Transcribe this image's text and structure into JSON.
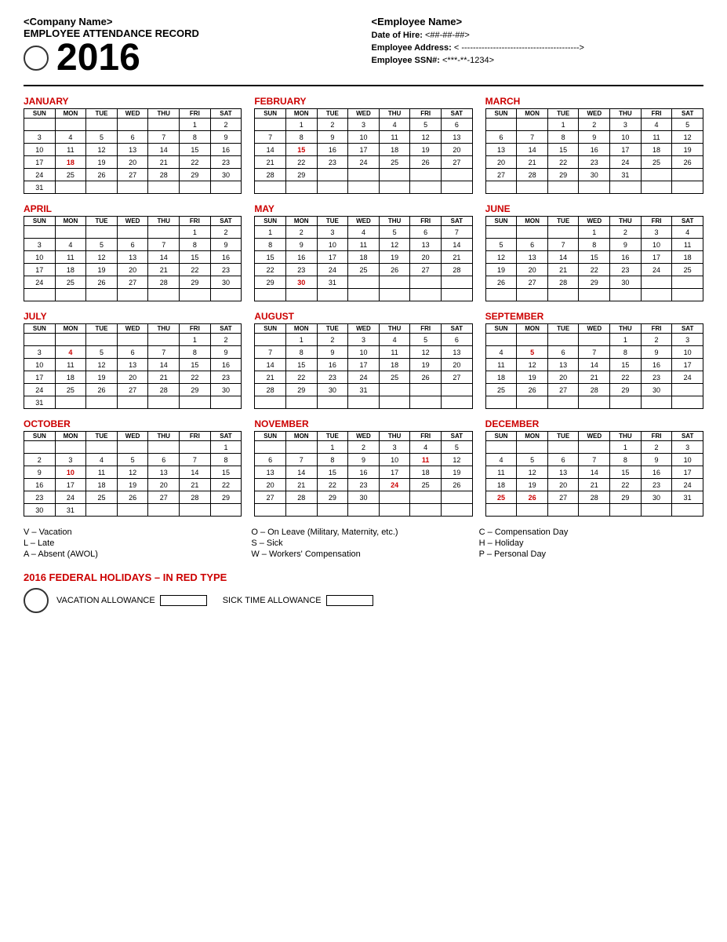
{
  "header": {
    "company_name": "<Company Name>",
    "record_title": "EMPLOYEE ATTENDANCE RECORD",
    "year": "2016",
    "employee_name": "<Employee Name>",
    "date_of_hire_label": "Date of Hire:",
    "date_of_hire_value": "<##-##-##>",
    "address_label": "Employee Address:",
    "address_value": "< ----------------------------------------->",
    "ssn_label": "Employee SSN#:",
    "ssn_value": "<***-**-1234>"
  },
  "legend": {
    "col1": [
      "V – Vacation",
      "L – Late",
      "A – Absent (AWOL)"
    ],
    "col2": [
      "O – On Leave (Military, Maternity, etc.)",
      "S – Sick",
      "W – Workers' Compensation"
    ],
    "col3": [
      "C – Compensation Day",
      "H – Holiday",
      "P – Personal Day"
    ]
  },
  "holidays_title": "2016 FEDERAL HOLIDAYS – IN RED TYPE",
  "vacation_label": "VACATION ALLOWANCE",
  "sick_label": "SICK TIME  ALLOWANCE",
  "months": [
    {
      "name": "JANUARY",
      "days": [
        [
          "",
          "",
          "",
          "",
          "",
          "1",
          "2"
        ],
        [
          "3",
          "4",
          "5",
          "6",
          "7",
          "8",
          "9"
        ],
        [
          "10",
          "11",
          "12",
          "13",
          "14",
          "15",
          "16"
        ],
        [
          "17",
          "18r",
          "19",
          "20",
          "21",
          "22",
          "23"
        ],
        [
          "24",
          "25",
          "26",
          "27",
          "28",
          "29",
          "30"
        ],
        [
          "31",
          "",
          "",
          "",
          "",
          "",
          ""
        ]
      ]
    },
    {
      "name": "FEBRUARY",
      "days": [
        [
          "",
          "1",
          "2",
          "3",
          "4",
          "5",
          "6"
        ],
        [
          "7",
          "8",
          "9",
          "10",
          "11",
          "12",
          "13"
        ],
        [
          "14",
          "15r",
          "16",
          "17",
          "18",
          "19",
          "20"
        ],
        [
          "21",
          "22",
          "23",
          "24",
          "25",
          "26",
          "27"
        ],
        [
          "28",
          "29",
          "",
          "",
          "",
          "",
          ""
        ],
        [
          "",
          "",
          "",
          "",
          "",
          "",
          ""
        ]
      ]
    },
    {
      "name": "MARCH",
      "days": [
        [
          "",
          "",
          "1",
          "2",
          "3",
          "4",
          "5"
        ],
        [
          "6",
          "7",
          "8",
          "9",
          "10",
          "11",
          "12"
        ],
        [
          "13",
          "14",
          "15",
          "16",
          "17",
          "18",
          "19"
        ],
        [
          "20",
          "21",
          "22",
          "23",
          "24",
          "25",
          "26"
        ],
        [
          "27",
          "28",
          "29",
          "30",
          "31",
          "",
          ""
        ],
        [
          "",
          "",
          "",
          "",
          "",
          "",
          ""
        ]
      ]
    },
    {
      "name": "APRIL",
      "days": [
        [
          "",
          "",
          "",
          "",
          "",
          "1",
          "2"
        ],
        [
          "3",
          "4",
          "5",
          "6",
          "7",
          "8",
          "9"
        ],
        [
          "10",
          "11",
          "12",
          "13",
          "14",
          "15",
          "16"
        ],
        [
          "17",
          "18",
          "19",
          "20",
          "21",
          "22",
          "23"
        ],
        [
          "24",
          "25",
          "26",
          "27",
          "28",
          "29",
          "30"
        ],
        [
          "",
          "",
          "",
          "",
          "",
          "",
          ""
        ]
      ]
    },
    {
      "name": "MAY",
      "days": [
        [
          "1",
          "2",
          "3",
          "4",
          "5",
          "6",
          "7"
        ],
        [
          "8",
          "9",
          "10",
          "11",
          "12",
          "13",
          "14"
        ],
        [
          "15",
          "16",
          "17",
          "18",
          "19",
          "20",
          "21"
        ],
        [
          "22",
          "23",
          "24",
          "25",
          "26",
          "27",
          "28"
        ],
        [
          "29",
          "30r",
          "31",
          "",
          "",
          "",
          ""
        ],
        [
          "",
          "",
          "",
          "",
          "",
          "",
          ""
        ]
      ]
    },
    {
      "name": "JUNE",
      "days": [
        [
          "",
          "",
          "",
          "1",
          "2",
          "3",
          "4"
        ],
        [
          "5",
          "6",
          "7",
          "8",
          "9",
          "10",
          "11"
        ],
        [
          "12",
          "13",
          "14",
          "15",
          "16",
          "17",
          "18"
        ],
        [
          "19",
          "20",
          "21",
          "22",
          "23",
          "24",
          "25"
        ],
        [
          "26",
          "27",
          "28",
          "29",
          "30",
          "",
          ""
        ],
        [
          "",
          "",
          "",
          "",
          "",
          "",
          ""
        ]
      ]
    },
    {
      "name": "JULY",
      "days": [
        [
          "",
          "",
          "",
          "",
          "",
          "1",
          "2"
        ],
        [
          "3",
          "4r",
          "5",
          "6",
          "7",
          "8",
          "9"
        ],
        [
          "10",
          "11",
          "12",
          "13",
          "14",
          "15",
          "16"
        ],
        [
          "17",
          "18",
          "19",
          "20",
          "21",
          "22",
          "23"
        ],
        [
          "24",
          "25",
          "26",
          "27",
          "28",
          "29",
          "30"
        ],
        [
          "31",
          "",
          "",
          "",
          "",
          "",
          ""
        ]
      ]
    },
    {
      "name": "AUGUST",
      "days": [
        [
          "",
          "1",
          "2",
          "3",
          "4",
          "5",
          "6"
        ],
        [
          "7",
          "8",
          "9",
          "10",
          "11",
          "12",
          "13"
        ],
        [
          "14",
          "15",
          "16",
          "17",
          "18",
          "19",
          "20"
        ],
        [
          "21",
          "22",
          "23",
          "24",
          "25",
          "26",
          "27"
        ],
        [
          "28",
          "29",
          "30",
          "31",
          "",
          "",
          ""
        ],
        [
          "",
          "",
          "",
          "",
          "",
          "",
          ""
        ]
      ]
    },
    {
      "name": "SEPTEMBER",
      "days": [
        [
          "",
          "",
          "",
          "",
          "1",
          "2",
          "3"
        ],
        [
          "4",
          "5r",
          "6",
          "7",
          "8",
          "9",
          "10"
        ],
        [
          "11",
          "12",
          "13",
          "14",
          "15",
          "16",
          "17"
        ],
        [
          "18",
          "19",
          "20",
          "21",
          "22",
          "23",
          "24"
        ],
        [
          "25",
          "26",
          "27",
          "28",
          "29",
          "30",
          ""
        ],
        [
          "",
          "",
          "",
          "",
          "",
          "",
          ""
        ]
      ]
    },
    {
      "name": "OCTOBER",
      "days": [
        [
          "",
          "",
          "",
          "",
          "",
          "",
          "1"
        ],
        [
          "2",
          "3",
          "4",
          "5",
          "6",
          "7",
          "8"
        ],
        [
          "9",
          "10r",
          "11",
          "12",
          "13",
          "14",
          "15"
        ],
        [
          "16",
          "17",
          "18",
          "19",
          "20",
          "21",
          "22"
        ],
        [
          "23",
          "24",
          "25",
          "26",
          "27",
          "28",
          "29"
        ],
        [
          "30",
          "31",
          "",
          "",
          "",
          "",
          ""
        ]
      ]
    },
    {
      "name": "NOVEMBER",
      "days": [
        [
          "",
          "",
          "1",
          "2",
          "3",
          "4",
          "5"
        ],
        [
          "6",
          "7",
          "8",
          "9",
          "10",
          "11r",
          "12"
        ],
        [
          "13",
          "14",
          "15",
          "16",
          "17",
          "18",
          "19"
        ],
        [
          "20",
          "21",
          "22",
          "23",
          "24r",
          "25",
          "26"
        ],
        [
          "27",
          "28",
          "29",
          "30",
          "",
          "",
          ""
        ],
        [
          "",
          "",
          "",
          "",
          "",
          "",
          ""
        ]
      ]
    },
    {
      "name": "DECEMBER",
      "days": [
        [
          "",
          "",
          "",
          "",
          "1",
          "2",
          "3"
        ],
        [
          "4",
          "5",
          "6",
          "7",
          "8",
          "9",
          "10"
        ],
        [
          "11",
          "12",
          "13",
          "14",
          "15",
          "16",
          "17"
        ],
        [
          "18",
          "19",
          "20",
          "21",
          "22",
          "23",
          "24"
        ],
        [
          "25r",
          "26r",
          "27",
          "28",
          "29",
          "30",
          "31"
        ],
        [
          "",
          "",
          "",
          "",
          "",
          "",
          ""
        ]
      ]
    }
  ]
}
